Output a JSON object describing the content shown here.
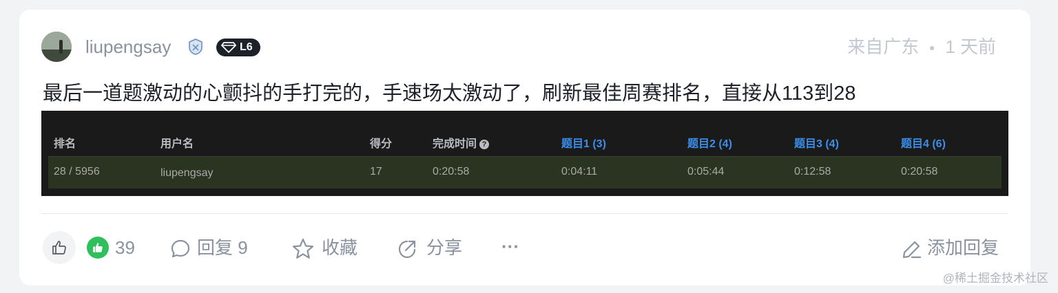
{
  "post": {
    "username": "liupengsay",
    "level": "L6",
    "location": "来自广东",
    "time": "1 天前",
    "content": "最后一道题激动的心颤抖的手打完的，手速场太激动了，刷新最佳周赛排名，直接从113到28"
  },
  "screenshot_table": {
    "headers": {
      "rank": "排名",
      "user": "用户名",
      "score": "得分",
      "finish_time": "完成时间",
      "q1": "题目1 (3)",
      "q2": "题目2 (4)",
      "q3": "题目3 (4)",
      "q4": "题目4 (6)"
    },
    "row": {
      "rank": "28 / 5956",
      "user": "liupengsay",
      "score": "17",
      "finish_time": "0:20:58",
      "q1": "0:04:11",
      "q2": "0:05:44",
      "q3": "0:12:58",
      "q4": "0:20:58"
    }
  },
  "actions": {
    "like_count": "39",
    "reply_label": "回复 9",
    "collect_label": "收藏",
    "share_label": "分享",
    "more_label": "···",
    "add_reply_label": "添加回复"
  },
  "watermark": "@稀土掘金技术社区",
  "colors": {
    "accent_green": "#2fbf5b",
    "link_blue": "#3b8eea",
    "text_gray": "#8a919f"
  }
}
